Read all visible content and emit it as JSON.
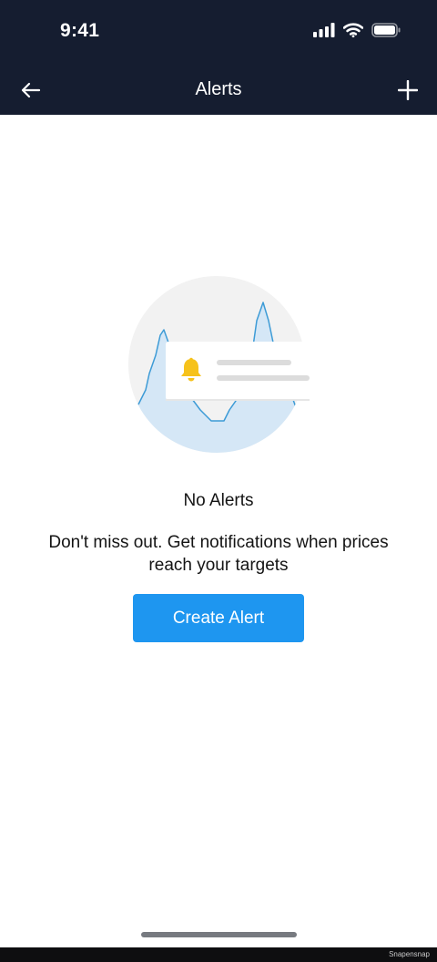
{
  "status_bar": {
    "time": "9:41",
    "icons": [
      "signal-icon",
      "wifi-icon",
      "battery-icon"
    ]
  },
  "nav": {
    "title": "Alerts",
    "back_icon": "arrow-left-icon",
    "add_icon": "plus-icon"
  },
  "empty_state": {
    "illustration_icon": "bell-icon",
    "title": "No Alerts",
    "description": "Don't miss out. Get notifications when prices reach your targets",
    "button_label": "Create Alert"
  },
  "watermark": "Snapensnap",
  "colors": {
    "header_bg": "#151d30",
    "button_bg": "#1e96f0",
    "bell": "#f6c21b",
    "chart_fill": "#d5e7f6",
    "chart_line": "#3d9bd6"
  }
}
